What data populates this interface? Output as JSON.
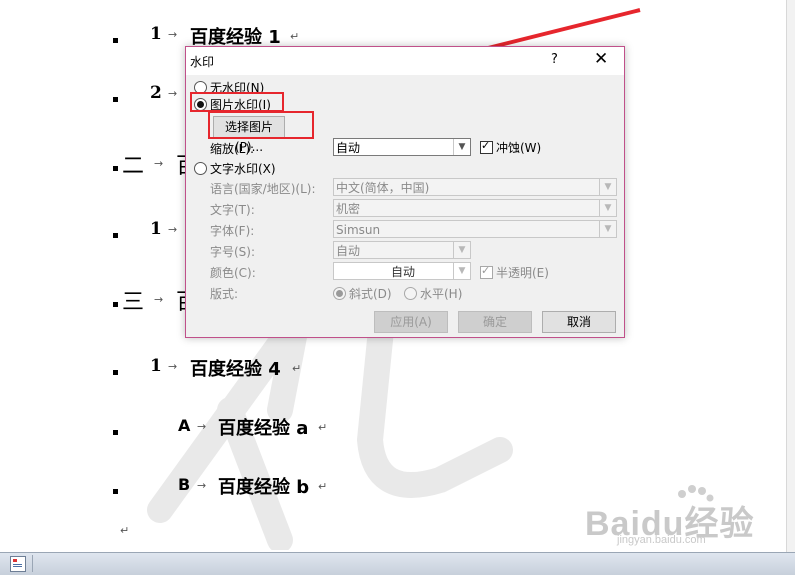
{
  "document": {
    "items": [
      {
        "num": "1",
        "text": "百度经验 1"
      },
      {
        "num": "2",
        "text": ""
      },
      {
        "num": "二",
        "text": ""
      },
      {
        "num": "1",
        "text": ""
      },
      {
        "num": "三",
        "text": ""
      },
      {
        "num": "1",
        "text": "百度经验 4"
      },
      {
        "num": "A",
        "text": "百度经验 a"
      },
      {
        "num": "B",
        "text": "百度经验 b"
      }
    ],
    "tab_arrow": "→",
    "para_mark": "↵"
  },
  "dialog": {
    "title": "水印",
    "help": "?",
    "close": "✕",
    "no_watermark": "无水印(N)",
    "picture_watermark": "图片水印(I)",
    "select_picture": "选择图片(P)...",
    "scale_label": "缩放(L):",
    "scale_value": "自动",
    "washout_label": "冲蚀(W)",
    "text_watermark": "文字水印(X)",
    "language_label": "语言(国家/地区)(L):",
    "language_value": "中文(简体，中国)",
    "text_label": "文字(T):",
    "text_value": "机密",
    "font_label": "字体(F):",
    "font_value": "Simsun",
    "size_label": "字号(S):",
    "size_value": "自动",
    "color_label": "颜色(C):",
    "color_value": "自动",
    "semitransparent_label": "半透明(E)",
    "layout_label": "版式:",
    "diagonal_label": "斜式(D)",
    "horizontal_label": "水平(H)",
    "apply": "应用(A)",
    "ok": "确定",
    "cancel": "取消"
  },
  "branding": {
    "logo_text": "Baidu经验",
    "logo_url_text": "jingyan.baidu.com"
  },
  "colors": {
    "annotation_red": "#e6262d",
    "dialog_border": "#c0508a"
  }
}
